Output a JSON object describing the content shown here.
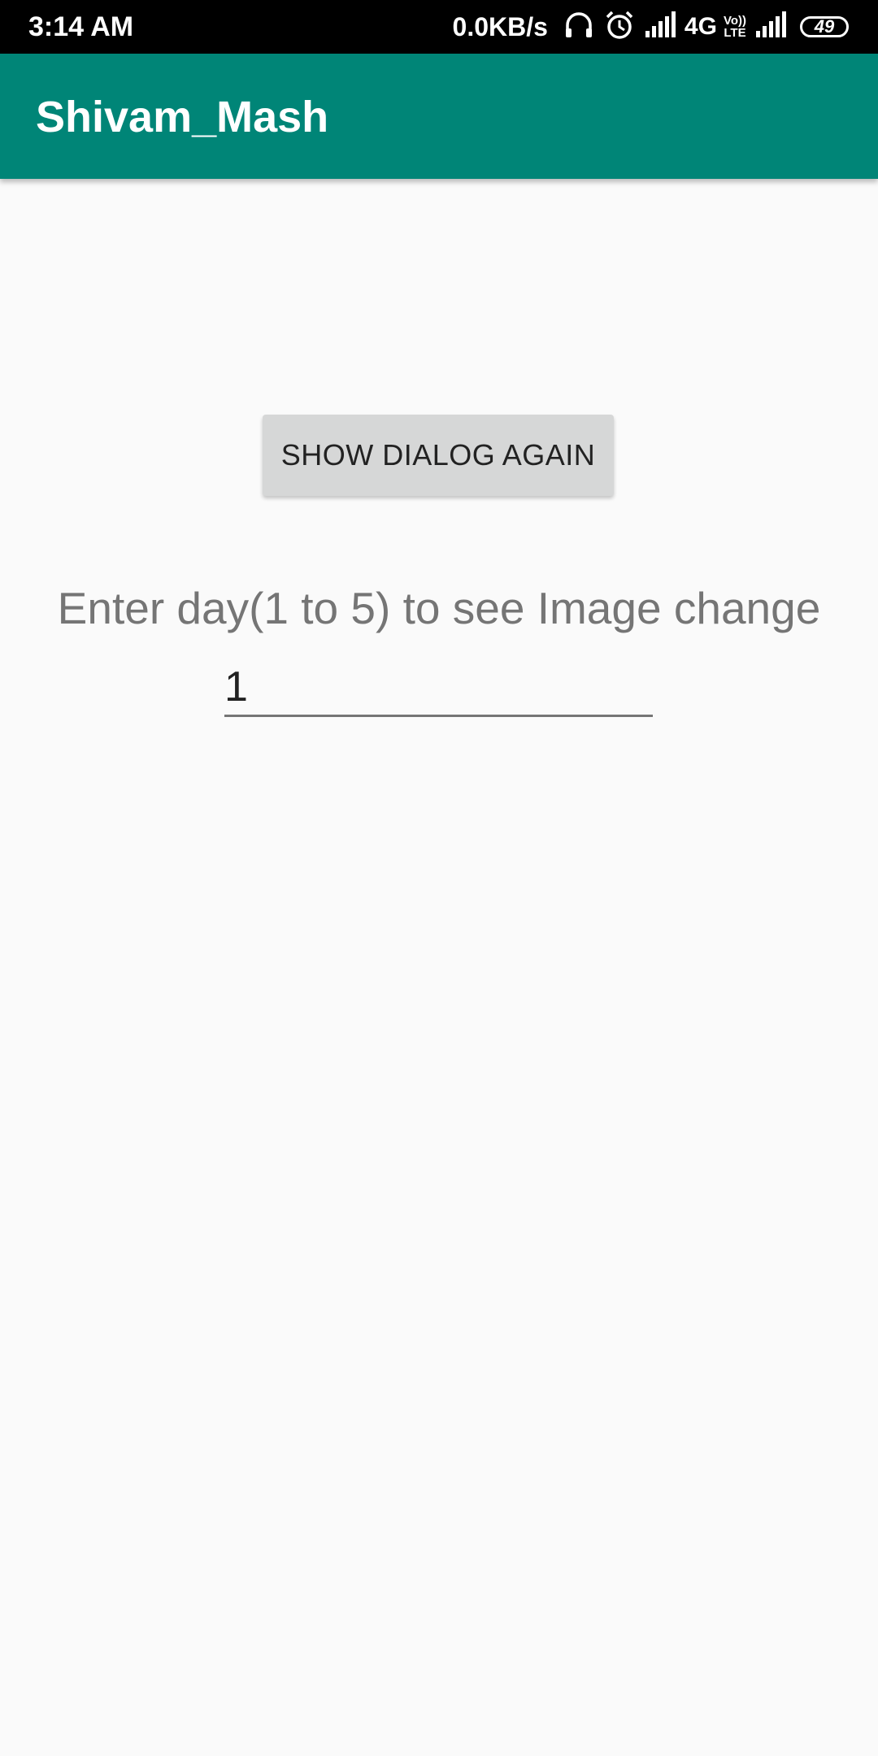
{
  "status_bar": {
    "time": "3:14 AM",
    "net_speed": "0.0KB/s",
    "network_type": "4G",
    "volte_top": "Vo))",
    "volte_bottom": "LTE",
    "battery": "49",
    "icons": [
      "headphones-icon",
      "alarm-icon",
      "signal-icon",
      "signal-icon"
    ]
  },
  "app_bar": {
    "title": "Shivam_Mash",
    "color": "#008577"
  },
  "main": {
    "dialog_button_label": "SHOW DIALOG AGAIN",
    "prompt_label": "Enter day(1 to 5) to see Image change",
    "day_input_value": "1"
  }
}
